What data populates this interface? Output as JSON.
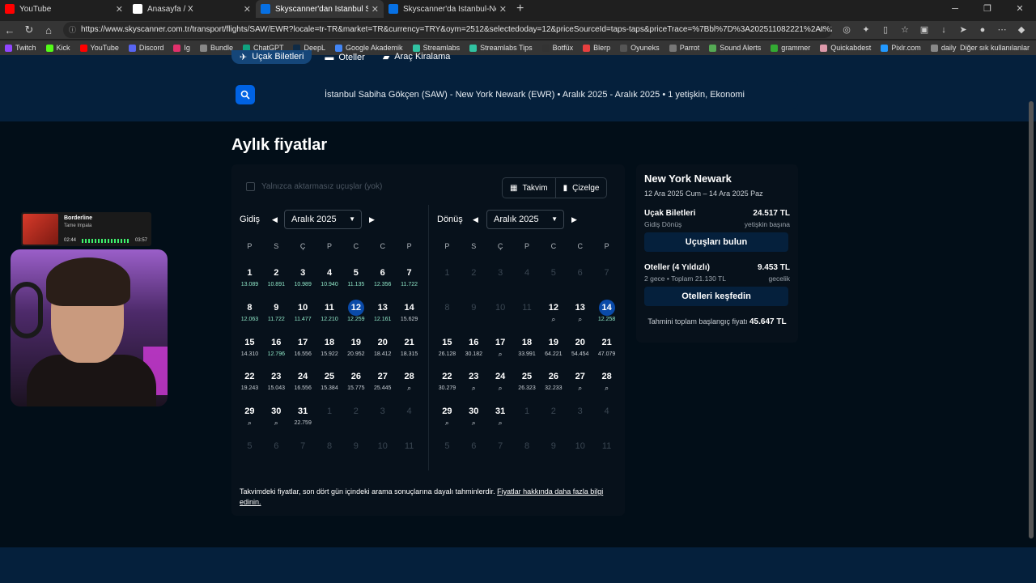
{
  "browser": {
    "tabs": [
      {
        "title": "YouTube",
        "icon": "youtube-icon",
        "color": "#ff0000",
        "active": false
      },
      {
        "title": "Anasayfa / X",
        "icon": "x-icon",
        "color": "#ffffff",
        "active": false
      },
      {
        "title": "Skyscanner'dan İstanbul Sabiha G",
        "icon": "skyscanner-icon",
        "color": "#0770e3",
        "active": true
      },
      {
        "title": "Skyscanner'da İstanbul-New York",
        "icon": "skyscanner-icon",
        "color": "#0770e3",
        "active": false
      }
    ],
    "url": "https://www.skyscanner.com.tr/transport/flights/SAW/EWR?locale=tr-TR&market=TR&currency=TRY&oym=2512&selectedoday=12&priceSourceId=taps-taps&priceTrace=%7Bbl%7D%3A202511082221%2AI%2ASAW...",
    "bookmarks": [
      "Twitch",
      "Kick",
      "YouTube",
      "Discord",
      "Ig",
      "Bundle",
      "ChatGPT",
      "DeepL",
      "Google Akademik",
      "Streamlabs",
      "Streamlabs Tips",
      "Botfüx",
      "Blerp",
      "Oyuneks",
      "Parrot",
      "Sound Alerts",
      "grammer",
      "Quickabdest",
      "Pixlr.com",
      "daily"
    ],
    "other_bookmarks": "Diğer sık kullanılanlar"
  },
  "site": {
    "nav": [
      "Uçak Biletleri",
      "Oteller",
      "Araç Kiralama"
    ],
    "search_summary": "İstanbul Sabiha Gökçen (SAW) - New York Newark (EWR)  •  Aralık 2025 - Aralık 2025  •  1 yetişkin, Ekonomi",
    "page_title": "Aylık fiyatlar",
    "direct_only": "Yalnızca aktarmasız uçuşlar (yok)",
    "view_calendar": "Takvim",
    "view_chart": "Çizelge",
    "outbound_label": "Gidiş",
    "return_label": "Dönüş",
    "outbound_month": "Aralık 2025",
    "return_month": "Aralık 2025",
    "weekdays": [
      "P",
      "S",
      "Ç",
      "P",
      "C",
      "C",
      "P"
    ],
    "outbound_rows": [
      [
        [
          "1",
          "13.089",
          1
        ],
        [
          "2",
          "10.891",
          1
        ],
        [
          "3",
          "10.989",
          1
        ],
        [
          "4",
          "10.940",
          1
        ],
        [
          "5",
          "11.135",
          1
        ],
        [
          "6",
          "12.356",
          1
        ],
        [
          "7",
          "11.722",
          1
        ]
      ],
      [
        [
          "8",
          "12.063",
          1
        ],
        [
          "9",
          "11.722",
          1
        ],
        [
          "10",
          "11.477",
          1
        ],
        [
          "11",
          "12.210",
          1
        ],
        [
          "12",
          "12.259",
          1,
          "sel"
        ],
        [
          "13",
          "12.161",
          1
        ],
        [
          "14",
          "15.629",
          0
        ]
      ],
      [
        [
          "15",
          "14.310",
          0
        ],
        [
          "16",
          "12.796",
          1
        ],
        [
          "17",
          "16.556",
          0
        ],
        [
          "18",
          "15.922",
          0
        ],
        [
          "19",
          "20.952",
          0
        ],
        [
          "20",
          "18.412",
          0
        ],
        [
          "21",
          "18.315",
          0
        ]
      ],
      [
        [
          "22",
          "19.243",
          0
        ],
        [
          "23",
          "15.043",
          0
        ],
        [
          "24",
          "16.556",
          0
        ],
        [
          "25",
          "15.384",
          0
        ],
        [
          "26",
          "15.775",
          0
        ],
        [
          "27",
          "25.445",
          0
        ],
        [
          "28",
          "Q",
          0
        ]
      ],
      [
        [
          "29",
          "Q",
          0
        ],
        [
          "30",
          "Q",
          0
        ],
        [
          "31",
          "22.759",
          0
        ],
        [
          "1",
          "",
          0,
          "dim"
        ],
        [
          "2",
          "",
          0,
          "dim"
        ],
        [
          "3",
          "",
          0,
          "dim"
        ],
        [
          "4",
          "",
          0,
          "dim"
        ]
      ],
      [
        [
          "5",
          "",
          0,
          "dim"
        ],
        [
          "6",
          "",
          0,
          "dim"
        ],
        [
          "7",
          "",
          0,
          "dim"
        ],
        [
          "8",
          "",
          0,
          "dim"
        ],
        [
          "9",
          "",
          0,
          "dim"
        ],
        [
          "10",
          "",
          0,
          "dim"
        ],
        [
          "11",
          "",
          0,
          "dim"
        ]
      ]
    ],
    "return_rows": [
      [
        [
          "1",
          "",
          0,
          "dim"
        ],
        [
          "2",
          "",
          0,
          "dim"
        ],
        [
          "3",
          "",
          0,
          "dim"
        ],
        [
          "4",
          "",
          0,
          "dim"
        ],
        [
          "5",
          "",
          0,
          "dim"
        ],
        [
          "6",
          "",
          0,
          "dim"
        ],
        [
          "7",
          "",
          0,
          "dim"
        ]
      ],
      [
        [
          "8",
          "",
          0,
          "dim"
        ],
        [
          "9",
          "",
          0,
          "dim"
        ],
        [
          "10",
          "",
          0,
          "dim"
        ],
        [
          "11",
          "",
          0,
          "dim"
        ],
        [
          "12",
          "Q",
          0
        ],
        [
          "13",
          "Q",
          0
        ],
        [
          "14",
          "12.258",
          1,
          "sel"
        ]
      ],
      [
        [
          "15",
          "26.128",
          0
        ],
        [
          "16",
          "30.182",
          0
        ],
        [
          "17",
          "Q",
          0
        ],
        [
          "18",
          "33.991",
          0
        ],
        [
          "19",
          "64.221",
          0
        ],
        [
          "20",
          "54.454",
          0
        ],
        [
          "21",
          "47.079",
          0
        ]
      ],
      [
        [
          "22",
          "30.279",
          0
        ],
        [
          "23",
          "Q",
          0
        ],
        [
          "24",
          "Q",
          0
        ],
        [
          "25",
          "26.323",
          0
        ],
        [
          "26",
          "32.233",
          0
        ],
        [
          "27",
          "Q",
          0
        ],
        [
          "28",
          "Q",
          0
        ]
      ],
      [
        [
          "29",
          "Q",
          0
        ],
        [
          "30",
          "Q",
          0
        ],
        [
          "31",
          "Q",
          0
        ],
        [
          "1",
          "",
          0,
          "dim"
        ],
        [
          "2",
          "",
          0,
          "dim"
        ],
        [
          "3",
          "",
          0,
          "dim"
        ],
        [
          "4",
          "",
          0,
          "dim"
        ]
      ],
      [
        [
          "5",
          "",
          0,
          "dim"
        ],
        [
          "6",
          "",
          0,
          "dim"
        ],
        [
          "7",
          "",
          0,
          "dim"
        ],
        [
          "8",
          "",
          0,
          "dim"
        ],
        [
          "9",
          "",
          0,
          "dim"
        ],
        [
          "10",
          "",
          0,
          "dim"
        ],
        [
          "11",
          "",
          0,
          "dim"
        ]
      ]
    ],
    "note": "Takvimdeki fiyatlar, son dört gün içindeki arama sonuçlarına dayalı tahminlerdir.",
    "note_link": "Fiyatlar hakkında daha fazla bilgi edinin.",
    "summary": {
      "destination": "New York Newark",
      "dates": "12 Ara 2025 Cum – 14 Ara 2025 Paz",
      "flights_label": "Uçak Biletleri",
      "flights_price": "24.517 TL",
      "flights_sub_left": "Gidiş Dönüş",
      "flights_sub_right": "yetişkin başına",
      "flights_cta": "Uçuşları bulun",
      "hotels_label": "Oteller (4 Yıldızlı)",
      "hotels_price": "9.453 TL",
      "hotels_sub_left": "2 gece • Toplam 21.130 TL",
      "hotels_sub_right": "gecelik",
      "hotels_cta": "Otelleri keşfedin",
      "total_label": "Tahmini toplam başlangıç fiyatı",
      "total_price": "45.647 TL"
    }
  },
  "overlay": {
    "song": "Borderline",
    "artist": "Tame Impala",
    "elapsed": "02:44",
    "duration": "03:57"
  }
}
